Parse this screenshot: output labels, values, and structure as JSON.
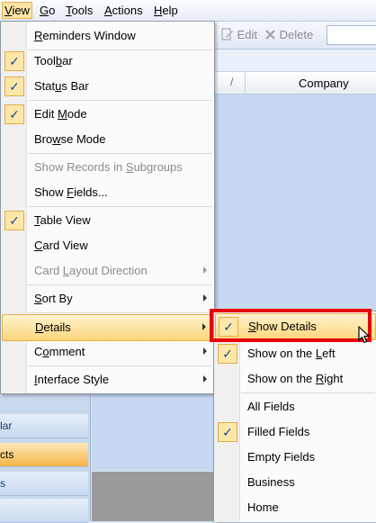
{
  "menubar": {
    "items": [
      {
        "label": "View",
        "ul": "V",
        "rest": "iew"
      },
      {
        "label": "Go",
        "ul": "G",
        "rest": "o"
      },
      {
        "label": "Tools",
        "ul": "T",
        "rest": "ools"
      },
      {
        "label": "Actions",
        "ul": "A",
        "rest": "ctions"
      },
      {
        "label": "Help",
        "ul": "H",
        "rest": "elp"
      }
    ]
  },
  "toolbar": {
    "edit_label": "Edit",
    "delete_label": "Delete"
  },
  "grid": {
    "sort_glyph": "/",
    "column_company": "Company"
  },
  "leftpane": {
    "items": [
      "lar",
      "cts",
      "s"
    ]
  },
  "view_menu": {
    "items": [
      {
        "pre": "",
        "ul": "R",
        "post": "eminders Window",
        "checked": false
      },
      {
        "pre": "Tool",
        "ul": "b",
        "post": "ar",
        "checked": true
      },
      {
        "pre": "Stat",
        "ul": "u",
        "post": "s Bar",
        "checked": true
      },
      {
        "pre": "Edit ",
        "ul": "M",
        "post": "ode",
        "checked": true
      },
      {
        "pre": "Bro",
        "ul": "w",
        "post": "se Mode",
        "checked": false
      },
      {
        "pre": "Show Records in ",
        "ul": "S",
        "post": "ubgroups",
        "checked": false,
        "disabled": true
      },
      {
        "pre": "Show ",
        "ul": "F",
        "post": "ields...",
        "checked": false
      },
      {
        "pre": "",
        "ul": "T",
        "post": "able View",
        "checked": true
      },
      {
        "pre": "",
        "ul": "C",
        "post": "ard View",
        "checked": false
      },
      {
        "pre": "Card ",
        "ul": "L",
        "post": "ayout Direction",
        "checked": false,
        "disabled": true,
        "submenu": true
      },
      {
        "pre": "",
        "ul": "S",
        "post": "ort By",
        "checked": false,
        "submenu": true
      },
      {
        "pre": "",
        "ul": "D",
        "post": "etails",
        "checked": false,
        "submenu": true,
        "highlighted": true
      },
      {
        "pre": "C",
        "ul": "o",
        "post": "mment",
        "checked": false,
        "submenu": true
      },
      {
        "pre": "",
        "ul": "I",
        "post": "nterface Style",
        "checked": false,
        "submenu": true
      }
    ]
  },
  "details_menu": {
    "items": [
      {
        "pre": "",
        "ul": "S",
        "post": "how Details",
        "checked": true,
        "highlighted": true
      },
      {
        "pre": "Show on the ",
        "ul": "L",
        "post": "eft",
        "checked": true
      },
      {
        "pre": "Show on the ",
        "ul": "R",
        "post": "ight",
        "checked": false
      },
      {
        "pre": "All Fields",
        "ul": "",
        "post": "",
        "checked": false
      },
      {
        "pre": "Filled Fields",
        "ul": "",
        "post": "",
        "checked": true
      },
      {
        "pre": "Empty Fields",
        "ul": "",
        "post": "",
        "checked": false
      },
      {
        "pre": "Business",
        "ul": "",
        "post": "",
        "checked": false
      },
      {
        "pre": "Home",
        "ul": "",
        "post": "",
        "checked": false
      }
    ]
  },
  "check_glyph": "✓",
  "colors": {
    "highlight": "#fcd57a",
    "check_bg": "#fde7a8",
    "annotation_box": "#e8000c"
  }
}
